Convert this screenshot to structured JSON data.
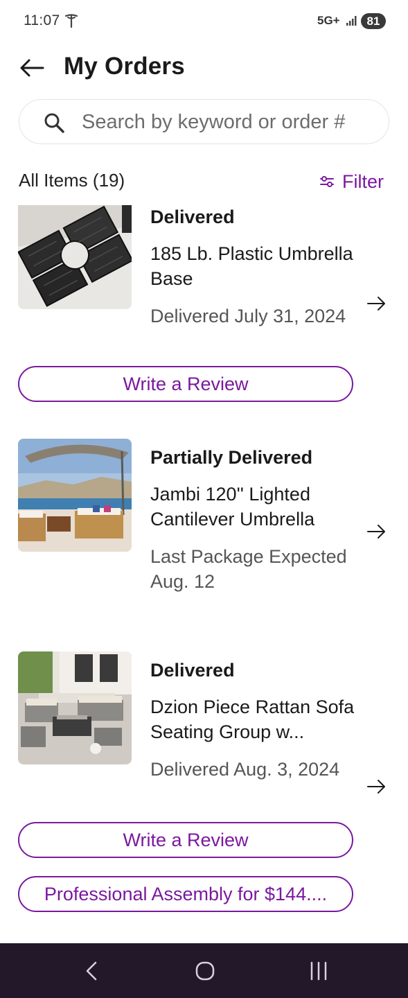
{
  "status_bar": {
    "time": "11:07",
    "network": "5G+",
    "battery": "81"
  },
  "header": {
    "title": "My Orders"
  },
  "search": {
    "placeholder": "Search by keyword or order #"
  },
  "list": {
    "count_label": "All Items (19)",
    "filter_label": "Filter"
  },
  "orders": [
    {
      "status": "Delivered",
      "name": "185 Lb. Plastic Umbrella Base",
      "date": "Delivered July 31, 2024",
      "review_label": "Write a Review"
    },
    {
      "status": "Partially Delivered",
      "name": "Jambi 120'' Lighted Cantilever Umbrella",
      "date": "Last Package Expected Aug. 12"
    },
    {
      "status": "Delivered",
      "name": "Dzion Piece Rattan Sofa Seating Group w...",
      "date": "Delivered Aug. 3, 2024",
      "review_label": "Write a Review",
      "assembly_label": "Professional Assembly for $144...."
    }
  ],
  "colors": {
    "accent": "#7b189f",
    "nav_bar": "#23182a"
  },
  "icons": {
    "back": "back-arrow-icon",
    "search": "search-icon",
    "filter": "filter-sliders-icon",
    "row_arrow": "arrow-right-icon"
  }
}
